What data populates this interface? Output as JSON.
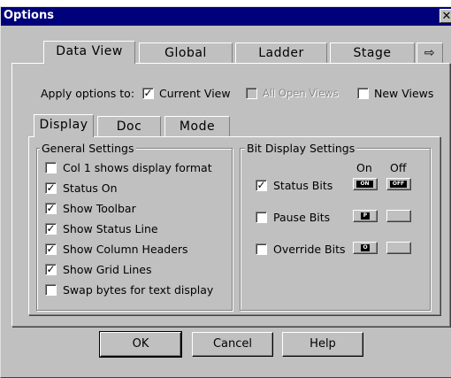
{
  "window": {
    "title": "Options",
    "close_glyph": "✕"
  },
  "top_tabs": [
    {
      "label": "Data View"
    },
    {
      "label": "Global"
    },
    {
      "label": "Ladder"
    },
    {
      "label": "Stage"
    }
  ],
  "tab_scroll_icon": "⇨",
  "apply": {
    "label": "Apply options to:",
    "options": [
      {
        "label": "Current View",
        "checked": true,
        "enabled": true
      },
      {
        "label": "All Open Views",
        "checked": false,
        "enabled": false
      },
      {
        "label": "New Views",
        "checked": false,
        "enabled": true
      }
    ]
  },
  "sub_tabs": [
    {
      "label": "Display"
    },
    {
      "label": "Doc"
    },
    {
      "label": "Mode"
    }
  ],
  "general": {
    "title": "General Settings",
    "items": [
      {
        "label": "Col 1 shows display format",
        "checked": false
      },
      {
        "label": "Status On",
        "checked": true
      },
      {
        "label": "Show Toolbar",
        "checked": true
      },
      {
        "label": "Show Status Line",
        "checked": true
      },
      {
        "label": "Show Column Headers",
        "checked": true
      },
      {
        "label": "Show Grid Lines",
        "checked": true
      },
      {
        "label": "Swap bytes for text display",
        "checked": false
      }
    ]
  },
  "bits": {
    "title": "Bit Display Settings",
    "on_header": "On",
    "off_header": "Off",
    "rows": [
      {
        "label": "Status Bits",
        "checked": true,
        "on_text": "ON",
        "off_text": "OFF"
      },
      {
        "label": "Pause Bits",
        "checked": false,
        "on_text": "P",
        "off_text": ""
      },
      {
        "label": "Override Bits",
        "checked": false,
        "on_text": "O",
        "off_text": ""
      }
    ]
  },
  "buttons": {
    "ok": "OK",
    "cancel": "Cancel",
    "help": "Help"
  }
}
